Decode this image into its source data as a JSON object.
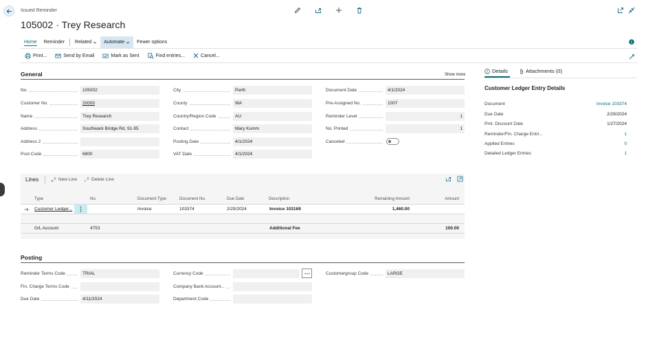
{
  "header": {
    "breadcrumb": "Issued Reminder",
    "title": "105002 · Trey Research"
  },
  "nav": {
    "tabs": [
      "Home",
      "Reminder",
      "Related",
      "Automate",
      "Fewer options"
    ]
  },
  "actions": [
    "Print...",
    "Send by Email",
    "Mark as Sent",
    "Find entries...",
    "Cancel..."
  ],
  "general": {
    "title": "General",
    "show_more": "Show more",
    "col1": [
      {
        "label": "No.",
        "value": "105002"
      },
      {
        "label": "Customer No.",
        "value": "20000"
      },
      {
        "label": "Name",
        "value": "Trey Research"
      },
      {
        "label": "Address",
        "value": "Southwark Bridge Rd, 91-95"
      },
      {
        "label": "Address 2",
        "value": ""
      },
      {
        "label": "Post Code",
        "value": "6800"
      }
    ],
    "col2": [
      {
        "label": "City",
        "value": "Perth"
      },
      {
        "label": "County",
        "value": "WA"
      },
      {
        "label": "Country/Region Code",
        "value": "AU"
      },
      {
        "label": "Contact",
        "value": "Mary Kumm"
      },
      {
        "label": "Posting Date",
        "value": "4/1/2024"
      },
      {
        "label": "VAT Date",
        "value": "4/1/2024"
      }
    ],
    "col3": [
      {
        "label": "Document Date",
        "value": "4/1/2024"
      },
      {
        "label": "Pre-Assigned No.",
        "value": "1007"
      },
      {
        "label": "Reminder Level",
        "value": "1"
      },
      {
        "label": "No. Printed",
        "value": "1"
      },
      {
        "label": "Canceled",
        "value": ""
      }
    ]
  },
  "lines": {
    "title": "Lines",
    "new_line": "New Line",
    "delete_line": "Delete Line",
    "columns": [
      "Type",
      "No.",
      "Document Type",
      "Document No.",
      "Due Date",
      "Description",
      "Remaining Amount",
      "Amount"
    ],
    "rows": [
      {
        "type": "Customer Ledger...",
        "no": "",
        "doc_type": "Invoice",
        "doc_no": "103374",
        "due": "2/29/2024",
        "desc": "Invoice 103169",
        "remaining": "1,460.00",
        "amount": ""
      },
      {
        "type": "G/L Account",
        "no": "4753",
        "doc_type": "",
        "doc_no": "",
        "due": "",
        "desc": "Additional Fee",
        "remaining": "",
        "amount": "100.00"
      }
    ]
  },
  "posting": {
    "title": "Posting",
    "col1": [
      {
        "label": "Reminder Terms Code",
        "value": "TRIAL"
      },
      {
        "label": "Fin. Charge Terms Code",
        "value": ""
      },
      {
        "label": "Due Date",
        "value": "4/11/2024"
      }
    ],
    "col2": [
      {
        "label": "Currency Code",
        "value": ""
      },
      {
        "label": "Company Bank Account...",
        "value": ""
      },
      {
        "label": "Department Code",
        "value": ""
      }
    ],
    "col3": [
      {
        "label": "Customergroup Code",
        "value": "LARGE"
      }
    ]
  },
  "factbox": {
    "tab_details": "Details",
    "tab_attachments": "Attachments (0)",
    "title": "Customer Ledger Entry Details",
    "rows": [
      {
        "label": "Document",
        "value": "Invoice 103374"
      },
      {
        "label": "Due Date",
        "value": "2/29/2024"
      },
      {
        "label": "Pmt. Discount Date",
        "value": "1/27/2024"
      },
      {
        "label": "Reminder/Fin. Charge Entri...",
        "value": "1"
      },
      {
        "label": "Applied Entries",
        "value": "0"
      },
      {
        "label": "Detailed Ledger Entries",
        "value": "1"
      }
    ]
  },
  "colors": {
    "accent": "#00707a",
    "highlight": "#d6e6f2",
    "field": "#f0f0f0"
  }
}
